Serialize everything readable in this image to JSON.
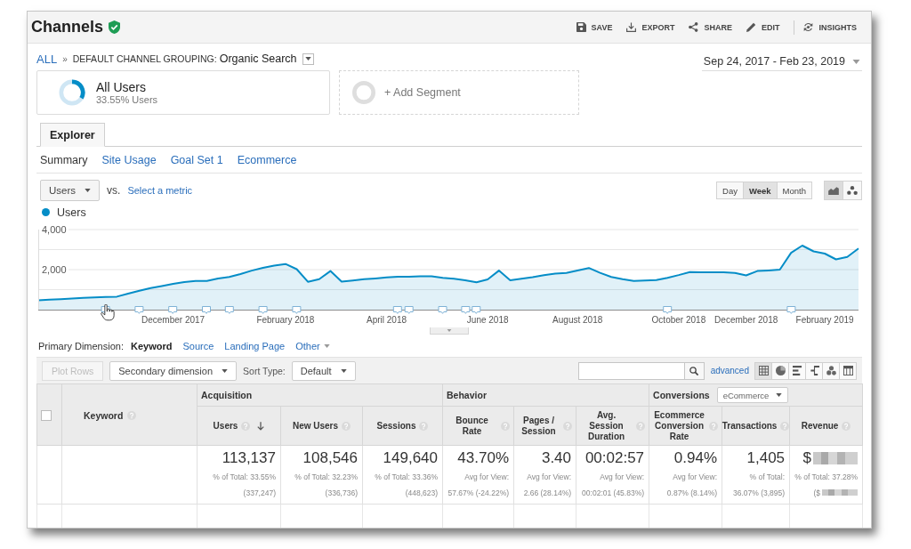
{
  "header": {
    "title": "Channels",
    "actions": [
      {
        "kind": "save",
        "label": "SAVE"
      },
      {
        "kind": "export",
        "label": "EXPORT"
      },
      {
        "kind": "share",
        "label": "SHARE"
      },
      {
        "kind": "edit",
        "label": "EDIT"
      },
      {
        "kind": "insights",
        "label": "INSIGHTS"
      }
    ]
  },
  "breadcrumb": {
    "root": "ALL",
    "separator": "»",
    "dimension": "DEFAULT CHANNEL GROUPING:",
    "value": "Organic Search"
  },
  "date_range": "Sep 24, 2017 - Feb 23, 2019",
  "segments": [
    {
      "kind": "segment",
      "name": "All Users",
      "detail": "33.55% Users",
      "level": 0.3355
    },
    {
      "kind": "add",
      "name": "+ Add Segment"
    }
  ],
  "report_tabs": [
    {
      "label": "Explorer",
      "selected": true
    }
  ],
  "sub_tabs": [
    {
      "label": "Summary",
      "selected": true
    },
    {
      "label": "Site Usage",
      "selected": false
    },
    {
      "label": "Goal Set 1",
      "selected": false
    },
    {
      "label": "Ecommerce",
      "selected": false
    }
  ],
  "metric": {
    "primary": "Users",
    "vs": "vs.",
    "secondary": "Select a metric"
  },
  "granularity": [
    {
      "label": "Day",
      "selected": false
    },
    {
      "label": "Week",
      "selected": true
    },
    {
      "label": "Month",
      "selected": false
    }
  ],
  "chart_types": [
    {
      "kind": "line",
      "selected": true
    },
    {
      "kind": "motion",
      "selected": false
    }
  ],
  "chart": {
    "chart_data": {
      "type": "area",
      "categories": [
        null,
        null,
        null,
        null,
        null,
        null,
        null,
        null,
        null,
        null,
        null,
        null,
        "December 2017",
        null,
        null,
        null,
        null,
        null,
        null,
        null,
        null,
        null,
        "February 2018",
        null,
        null,
        null,
        null,
        null,
        null,
        null,
        null,
        "April 2018",
        null,
        null,
        null,
        null,
        null,
        null,
        null,
        null,
        "June 2018",
        null,
        null,
        null,
        null,
        null,
        null,
        null,
        "August 2018",
        null,
        null,
        null,
        null,
        null,
        null,
        null,
        null,
        "October 2018",
        null,
        null,
        null,
        null,
        null,
        "December 2018",
        null,
        null,
        null,
        null,
        null,
        null,
        "February 2019",
        null,
        null,
        null
      ],
      "series": [
        {
          "name": "Users",
          "color": "#058dc7",
          "values": [
            470,
            500,
            520,
            550,
            590,
            610,
            630,
            650,
            800,
            940,
            1080,
            1180,
            1290,
            1380,
            1430,
            1430,
            1550,
            1630,
            1780,
            1950,
            2090,
            2200,
            2280,
            2020,
            1390,
            1520,
            1930,
            1400,
            1460,
            1520,
            1560,
            1610,
            1650,
            1640,
            1670,
            1670,
            1590,
            1540,
            1470,
            1370,
            1510,
            1950,
            1470,
            1540,
            1620,
            1720,
            1800,
            1830,
            1950,
            2080,
            1840,
            1630,
            1520,
            1430,
            1460,
            1480,
            1590,
            1730,
            1880,
            1870,
            1860,
            1870,
            1830,
            1710,
            1930,
            1960,
            2000,
            2840,
            3200,
            2910,
            2800,
            2510,
            2630,
            3060
          ]
        }
      ],
      "ylim": [
        0,
        4000
      ],
      "yticks": [
        {
          "value": 2000,
          "label": "2,000"
        },
        {
          "value": 4000,
          "label": "4,000"
        }
      ]
    }
  },
  "primary_dimension": {
    "label": "Primary Dimension:",
    "options": [
      {
        "kind": "link",
        "label": "Keyword",
        "selected": true
      },
      {
        "kind": "link",
        "label": "Source",
        "selected": false
      },
      {
        "kind": "link",
        "label": "Landing Page",
        "selected": false
      },
      {
        "kind": "menu",
        "label": "Other",
        "selected": false
      }
    ]
  },
  "table_toolbar": {
    "plot_rows": {
      "label": "Plot Rows",
      "disabled": true
    },
    "secondary_dimension": "Secondary dimension",
    "sort_label": "Sort Type:",
    "sort_value": "Default",
    "advanced": "advanced",
    "views": [
      {
        "kind": "table",
        "selected": true
      },
      {
        "kind": "pie",
        "selected": false
      },
      {
        "kind": "performance",
        "selected": false
      },
      {
        "kind": "comparison",
        "selected": false
      },
      {
        "kind": "term_cloud",
        "selected": false
      },
      {
        "kind": "pivot",
        "selected": false
      }
    ]
  },
  "table": {
    "select_all": {
      "checked": false
    },
    "dimension": {
      "label": "Keyword",
      "help": true
    },
    "groups": [
      {
        "label": "Acquisition",
        "columns": [
          {
            "label": "Users",
            "help": true,
            "sorted": true,
            "total": {
              "value": "113,137",
              "detail": "% of Total: 33.55% (337,247)",
              "redacted": false
            }
          },
          {
            "label": "New Users",
            "help": true,
            "sorted": false,
            "total": {
              "value": "108,546",
              "detail": "% of Total: 32.23% (336,736)",
              "redacted": false
            }
          },
          {
            "label": "Sessions",
            "help": true,
            "sorted": false,
            "total": {
              "value": "149,640",
              "detail": "% of Total: 33.36% (448,623)",
              "redacted": false
            }
          }
        ]
      },
      {
        "label": "Behavior",
        "columns": [
          {
            "label": "Bounce Rate",
            "help": true,
            "sorted": false,
            "total": {
              "value": "43.70%",
              "detail": "Avg for View: 57.67% (-24.22%)",
              "redacted": false
            }
          },
          {
            "label": "Pages / Session",
            "help": true,
            "sorted": false,
            "total": {
              "value": "3.40",
              "detail": "Avg for View: 2.66 (28.14%)",
              "redacted": false
            }
          },
          {
            "label": "Avg. Session Duration",
            "help": true,
            "sorted": false,
            "total": {
              "value": "00:02:57",
              "detail": "Avg for View: 00:02:01 (45.83%)",
              "redacted": false
            }
          }
        ]
      },
      {
        "label": "Conversions",
        "selector": "eCommerce",
        "columns": [
          {
            "label": "Ecommerce Conversion Rate",
            "help": true,
            "sorted": false,
            "total": {
              "value": "0.94%",
              "detail": "Avg for View: 0.87% (8.14%)",
              "redacted": false
            }
          },
          {
            "label": "Transactions",
            "help": true,
            "sorted": false,
            "total": {
              "value": "1,405",
              "detail": "% of Total: 36.07% (3,895)",
              "redacted": false
            }
          },
          {
            "label": "Revenue",
            "help": true,
            "sorted": false,
            "total": {
              "value": "$",
              "detail": "% of Total: 37.28% ($",
              "redacted": true
            }
          }
        ]
      }
    ]
  }
}
